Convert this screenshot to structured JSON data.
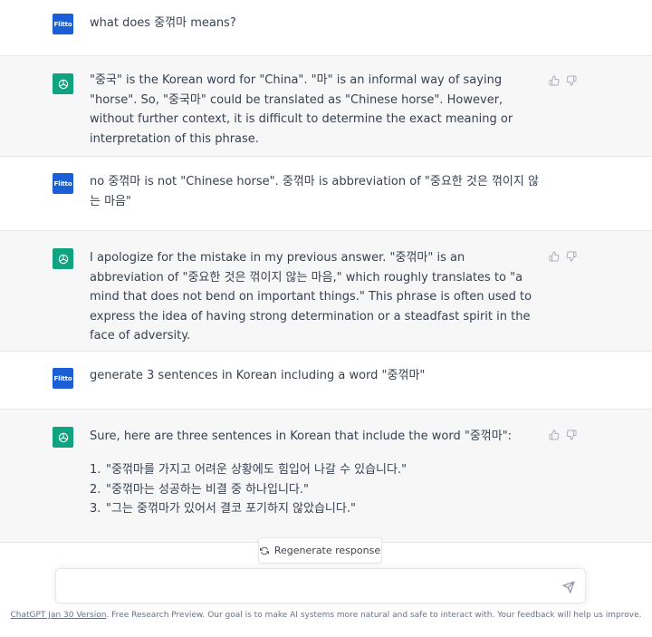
{
  "conversation": [
    {
      "role": "user",
      "avatar_label": "Flitto",
      "text": "what does 중꺾마 means?"
    },
    {
      "role": "assistant",
      "paragraph": "\"중국\" is the Korean word for \"China\". \"마\" is an informal way of saying \"horse\". So, \"중국마\" could be translated as \"Chinese horse\". However, without further context, it is difficult to determine the exact meaning or interpretation of this phrase."
    },
    {
      "role": "user",
      "avatar_label": "Flitto",
      "text": "no 중꺾마 is not \"Chinese horse\". 중꺾마 is abbreviation of \"중요한 것은 꺾이지 않는 마음\""
    },
    {
      "role": "assistant",
      "paragraph": "I apologize for the mistake in my previous answer. \"중꺾마\" is an abbreviation of \"중요한 것은 꺾이지 않는 마음,\" which roughly translates to \"a mind that does not bend on important things.\" This phrase is often used to express the idea of having strong determination or a steadfast spirit in the face of adversity."
    },
    {
      "role": "user",
      "avatar_label": "Flitto",
      "text": "generate 3 sentences in Korean including a word \"중꺾마\""
    },
    {
      "role": "assistant",
      "paragraph": "Sure, here are three sentences in Korean that include the word \"중꺾마\":",
      "list": [
        {
          "num": "1.",
          "text": "\"중꺾마를 가지고 어려운 상황에도 힘입어 나갈 수 있습니다.\""
        },
        {
          "num": "2.",
          "text": "\"중꺾마는 성공하는 비결 중 하나입니다.\""
        },
        {
          "num": "3.",
          "text": "\"그는 중꺾마가 있어서 결코 포기하지 않았습니다.\""
        }
      ]
    }
  ],
  "regenerate_label": "Regenerate response",
  "input": {
    "placeholder": "",
    "value": ""
  },
  "footer": {
    "link_text": "ChatGPT Jan 30 Version",
    "text": ". Free Research Preview. Our goal is to make AI systems more natural and safe to interact with. Your feedback will help us improve."
  },
  "colors": {
    "accent": "#10a37f",
    "user_avatar": "#1a5fd6",
    "assistant_bg": "#f7f7f8"
  },
  "icons": {
    "assistant_avatar": "openai-logo-icon",
    "thumbs_up": "thumbs-up-icon",
    "thumbs_down": "thumbs-down-icon",
    "regenerate": "refresh-icon",
    "send": "send-icon"
  }
}
